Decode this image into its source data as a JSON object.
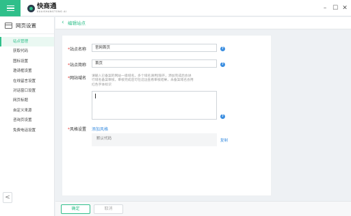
{
  "app": {
    "name": "快商通",
    "sub": "KUAISHANGTONG AI"
  },
  "window": {
    "minimize": "–",
    "maximize": "☐",
    "close": "✕"
  },
  "sidebar": {
    "title": "网页设置",
    "items": [
      {
        "label": "站点管理",
        "active": true
      },
      {
        "label": "获取代码"
      },
      {
        "label": "图标设置"
      },
      {
        "label": "邀请框设置"
      },
      {
        "label": "在线留言设置"
      },
      {
        "label": "对话窗口设置"
      },
      {
        "label": "网页标题"
      },
      {
        "label": "自定义来源"
      },
      {
        "label": "咨询页设置"
      },
      {
        "label": "免费电话设置"
      }
    ],
    "collapse": "<"
  },
  "breadcrumb": {
    "label": "编辑站点"
  },
  "form": {
    "site_name": {
      "label": "站点名称",
      "value": "官网首页"
    },
    "site_short": {
      "label": "站点简称",
      "value": "首页"
    },
    "domain": {
      "label": "网站域名",
      "note_lines": [
        "请输入已备案的网站一级域名，多个域名请用|隔开，添加完成后会进",
        "行域名备案审核，审核完成后可在这边查看审核结果，未备案域名会用",
        "红色字体标识"
      ]
    },
    "style": {
      "label": "风格设置",
      "add_link": "添加风格",
      "default": "默认代码",
      "copy": "复制"
    },
    "required_mark": "*",
    "help_glyph": "?"
  },
  "footer": {
    "ok": "确定",
    "cancel": "取消"
  },
  "colors": {
    "accent": "#2fbf8a",
    "link": "#3b8ee0",
    "required": "#e64340"
  }
}
